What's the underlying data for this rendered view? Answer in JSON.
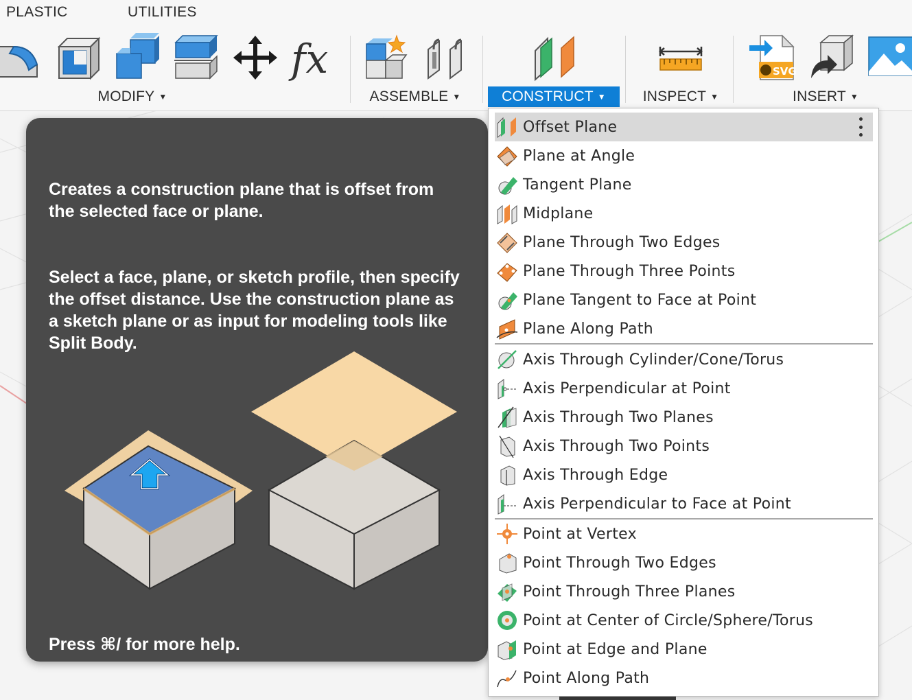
{
  "tabs": [
    {
      "label": "PLASTIC"
    },
    {
      "label": "UTILITIES"
    }
  ],
  "toolbar": {
    "modify_label": "MODIFY",
    "assemble_label": "ASSEMBLE",
    "construct_label": "CONSTRUCT",
    "inspect_label": "INSPECT",
    "insert_label": "INSERT",
    "caret": "▼",
    "accent_color": "#0f7fd6",
    "icons": [
      "fillet-icon",
      "shell-icon",
      "combine-icon",
      "press-pull-icon",
      "move-icon",
      "parameters-icon",
      "new-component-icon",
      "joint-icon",
      "offset-plane-icon",
      "measure-icon",
      "insert-svg-icon",
      "insert-mesh-icon",
      "insert-image-icon"
    ]
  },
  "tooltip": {
    "line1": "Creates a construction plane that is offset from the selected face or plane.",
    "line2": "Select a face, plane, or sketch profile, then specify the offset distance. Use the construction plane as a sketch plane or as input for modeling tools like Split Body.",
    "help": "Press ⌘/ for more help."
  },
  "menu": {
    "planes": [
      {
        "label": "Offset Plane",
        "icon": "offset-plane-icon"
      },
      {
        "label": "Plane at Angle",
        "icon": "plane-at-angle-icon"
      },
      {
        "label": "Tangent Plane",
        "icon": "tangent-plane-icon"
      },
      {
        "label": "Midplane",
        "icon": "midplane-icon"
      },
      {
        "label": "Plane Through Two Edges",
        "icon": "plane-two-edges-icon"
      },
      {
        "label": "Plane Through Three Points",
        "icon": "plane-three-points-icon"
      },
      {
        "label": "Plane Tangent to Face at Point",
        "icon": "plane-tangent-face-point-icon"
      },
      {
        "label": "Plane Along Path",
        "icon": "plane-along-path-icon"
      }
    ],
    "axes": [
      {
        "label": "Axis Through Cylinder/Cone/Torus",
        "icon": "axis-cylinder-icon"
      },
      {
        "label": "Axis Perpendicular at Point",
        "icon": "axis-perpendicular-point-icon"
      },
      {
        "label": "Axis Through Two Planes",
        "icon": "axis-two-planes-icon"
      },
      {
        "label": "Axis Through Two Points",
        "icon": "axis-two-points-icon"
      },
      {
        "label": "Axis Through Edge",
        "icon": "axis-edge-icon"
      },
      {
        "label": "Axis Perpendicular to Face at Point",
        "icon": "axis-perpendicular-face-icon"
      }
    ],
    "points": [
      {
        "label": "Point at Vertex",
        "icon": "point-vertex-icon"
      },
      {
        "label": "Point Through Two Edges",
        "icon": "point-two-edges-icon"
      },
      {
        "label": "Point Through Three Planes",
        "icon": "point-three-planes-icon"
      },
      {
        "label": "Point at Center of Circle/Sphere/Torus",
        "icon": "point-center-icon"
      },
      {
        "label": "Point at Edge and Plane",
        "icon": "point-edge-plane-icon"
      },
      {
        "label": "Point Along Path",
        "icon": "point-along-path-icon"
      }
    ],
    "highlighted": "Offset Plane"
  }
}
